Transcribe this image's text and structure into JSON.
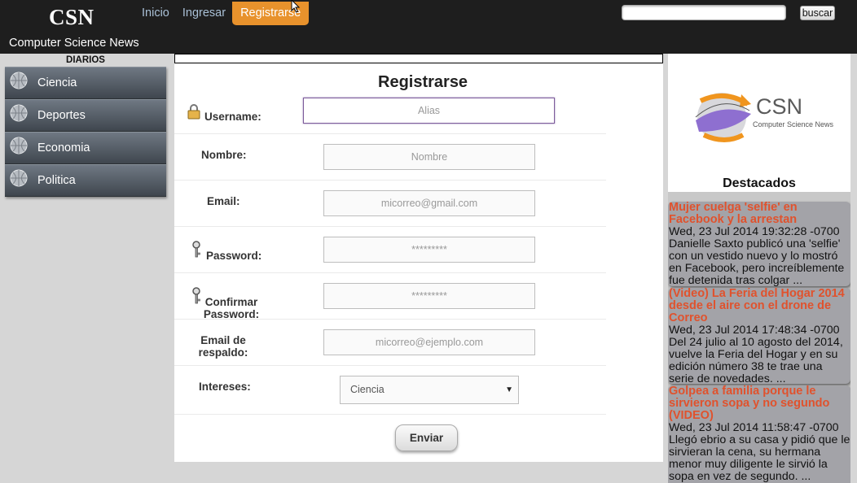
{
  "header": {
    "logo": "CSN",
    "tagline": "Computer Science News",
    "nav": [
      "Inicio",
      "Ingresar",
      "Registrarse"
    ],
    "search_button": "buscar"
  },
  "sidebar": {
    "title": "DIARIOS",
    "items": [
      "Ciencia",
      "Deportes",
      "Economia",
      "Politica"
    ]
  },
  "form": {
    "title": "Registrarse",
    "username_label": "Username:",
    "username_placeholder": "Alias",
    "nombre_label": "Nombre:",
    "nombre_placeholder": "Nombre",
    "email_label": "Email:",
    "email_placeholder": "micorreo@gmail.com",
    "password_label": "Password:",
    "password_placeholder": "*********",
    "confirm_label_1": "Confirmar",
    "confirm_label_2": "Password:",
    "confirm_placeholder": "*********",
    "backup_label_1": "Email de",
    "backup_label_2": "respaldo:",
    "backup_placeholder": "micorreo@ejemplo.com",
    "intereses_label": "Intereses:",
    "intereses_value": "Ciencia",
    "submit": "Enviar"
  },
  "right": {
    "brand_name": "CSN",
    "brand_subtitle": "Computer Science News",
    "destacados": "Destacados",
    "news": [
      {
        "title": "Mujer cuelga 'selfie' en Facebook y la arrestan",
        "date": "Wed, 23 Jul 2014 19:32:28 -0700",
        "text": "Danielle Saxto publicó una 'selfie' con un vestido nuevo y lo mostró en Facebook, pero increíblemente fue detenida tras colgar ..."
      },
      {
        "title": "(Video) La Feria del Hogar 2014 desde el aire con el drone de Correo",
        "date": "Wed, 23 Jul 2014 17:48:34 -0700",
        "text": "Del 24 julio al 10 agosto del 2014, vuelve la Feria del Hogar y en su edición número 38 te trae una serie de novedades. ..."
      },
      {
        "title": "Golpea a familia porque le sirvieron sopa y no segundo (VIDEO)",
        "date": "Wed, 23 Jul 2014 11:58:47 -0700",
        "text": "Llegó ebrio a su casa y pidió que le sirvieran la cena, su hermana menor muy diligente le sirvió la sopa en vez de segundo. ..."
      }
    ]
  },
  "colors": {
    "header_bg": "#1e1e1e",
    "nav_active": "#e8922c",
    "news_title": "#e0522d"
  }
}
